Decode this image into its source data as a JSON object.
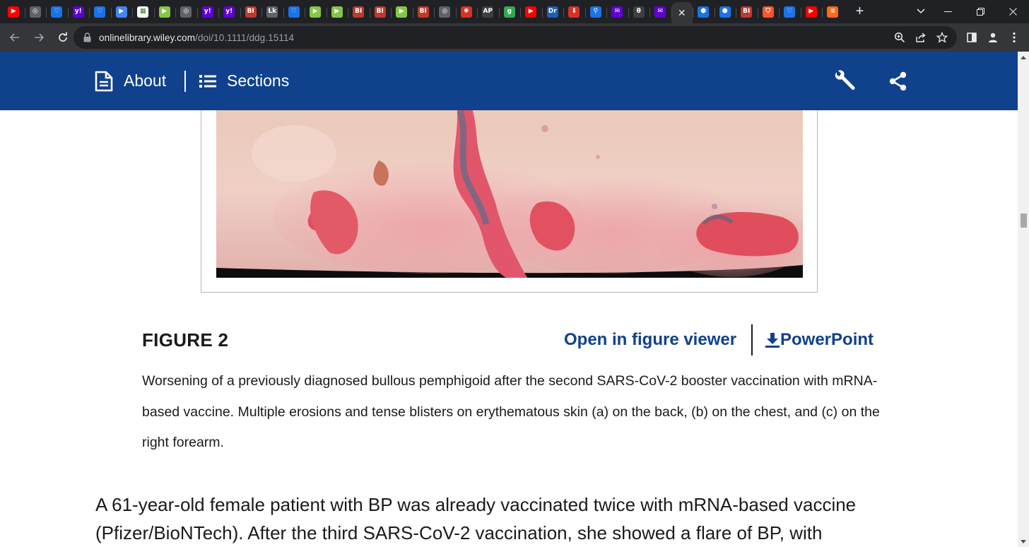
{
  "browser": {
    "tabs": [
      {
        "icon": "youtube-icon",
        "color": "#ff0000",
        "glyph": "▶"
      },
      {
        "icon": "globe-icon",
        "color": "#5f6368",
        "glyph": "◎"
      },
      {
        "icon": "shield-icon",
        "color": "#1a73e8",
        "glyph": "♡"
      },
      {
        "icon": "yahoo-icon",
        "color": "#6001d2",
        "glyph": "y!"
      },
      {
        "icon": "shield-icon",
        "color": "#1a73e8",
        "glyph": "♡"
      },
      {
        "icon": "bookmark-icon",
        "color": "#4285f4",
        "glyph": "▶"
      },
      {
        "icon": "image-icon",
        "color": "#ffffff",
        "glyph": "▦"
      },
      {
        "icon": "rumble-icon",
        "color": "#85c742",
        "glyph": "▶"
      },
      {
        "icon": "globe-icon",
        "color": "#5f6368",
        "glyph": "◎"
      },
      {
        "icon": "yahoo-icon",
        "color": "#6001d2",
        "glyph": "y!"
      },
      {
        "icon": "yahoo-icon",
        "color": "#6001d2",
        "glyph": "y!"
      },
      {
        "icon": "business-insider-icon",
        "color": "#c0392b",
        "glyph": "BI"
      },
      {
        "icon": "text-icon",
        "color": "#5f6368",
        "glyph": "Lk"
      },
      {
        "icon": "shield-icon",
        "color": "#1a73e8",
        "glyph": "♡"
      },
      {
        "icon": "rumble-icon",
        "color": "#85c742",
        "glyph": "▶"
      },
      {
        "icon": "rumble-icon",
        "color": "#85c742",
        "glyph": "▶"
      },
      {
        "icon": "business-insider-icon",
        "color": "#c0392b",
        "glyph": "BI"
      },
      {
        "icon": "business-insider-icon",
        "color": "#c0392b",
        "glyph": "BI"
      },
      {
        "icon": "rumble-icon",
        "color": "#85c742",
        "glyph": "▶"
      },
      {
        "icon": "business-insider-icon",
        "color": "#c0392b",
        "glyph": "BI"
      },
      {
        "icon": "globe-icon",
        "color": "#5f6368",
        "glyph": "◎"
      },
      {
        "icon": "burst-icon",
        "color": "#d93025",
        "glyph": "✺"
      },
      {
        "icon": "news-icon",
        "color": "#3c4043",
        "glyph": "AP"
      },
      {
        "icon": "g-icon",
        "color": "#34a853",
        "glyph": "g"
      },
      {
        "icon": "youtube-icon",
        "color": "#ff0000",
        "glyph": "▶"
      },
      {
        "icon": "dr-icon",
        "color": "#1a5fb4",
        "glyph": "Dr"
      },
      {
        "icon": "pin-icon",
        "color": "#d93025",
        "glyph": "⬇"
      },
      {
        "icon": "search-icon",
        "color": "#1a73e8",
        "glyph": "⚲"
      },
      {
        "icon": "mail-icon",
        "color": "#6001d2",
        "glyph": "✉"
      },
      {
        "icon": "theta-icon",
        "color": "#3c4043",
        "glyph": "θ"
      },
      {
        "icon": "mail-icon",
        "color": "#6001d2",
        "glyph": "✉"
      },
      {
        "icon": "close-icon",
        "color": "#35363a",
        "glyph": "✕",
        "active": true
      },
      {
        "icon": "hexagon-icon",
        "color": "#1a73e8",
        "glyph": "⬢"
      },
      {
        "icon": "hexagon-icon",
        "color": "#1a73e8",
        "glyph": "⬢"
      },
      {
        "icon": "business-insider-icon",
        "color": "#c0392b",
        "glyph": "BI"
      },
      {
        "icon": "brave-shield-icon",
        "color": "#fb542b",
        "glyph": "⛉"
      },
      {
        "icon": "shield-icon",
        "color": "#1a73e8",
        "glyph": "♡"
      },
      {
        "icon": "youtube-icon",
        "color": "#ff0000",
        "glyph": "▶"
      },
      {
        "icon": "substack-icon",
        "color": "#ff6719",
        "glyph": "≡"
      }
    ],
    "new_tab_label": "+",
    "url_host": "onlinelibrary.wiley.com",
    "url_path": "/doi/10.1111/ddg.15114"
  },
  "wiley_bar": {
    "about_label": "About",
    "sections_label": "Sections"
  },
  "figure": {
    "label": "FIGURE 2",
    "viewer_link": "Open in figure viewer",
    "ppt_link": "PowerPoint",
    "caption": "Worsening of a previously diagnosed bullous pemphigoid after the second SARS-CoV-2 booster vaccination with mRNA-based vaccine. Multiple erosions and tense blisters on erythematous skin (a) on the back, (b) on the chest, and (c) on the right forearm."
  },
  "article": {
    "paragraph": "A 61-year-old female patient with BP was already vaccinated twice with mRNA-based vaccine (Pfizer/BioNTech). After the third SARS-CoV-2 vaccination, she showed a flare of BP, with"
  },
  "colors": {
    "wiley_blue": "#10418c",
    "chrome_dark": "#202124",
    "chrome_toolbar": "#35363a"
  }
}
